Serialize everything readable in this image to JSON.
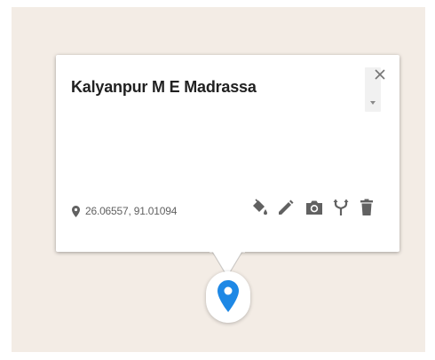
{
  "popup": {
    "title": "Kalyanpur M E Madrassa",
    "coordinates": "26.06557, 91.01094",
    "close_icon": "close-icon",
    "actions": [
      {
        "name": "style-button",
        "icon": "paint-bucket-icon"
      },
      {
        "name": "edit-button",
        "icon": "pencil-icon"
      },
      {
        "name": "add-photo-button",
        "icon": "camera-icon"
      },
      {
        "name": "directions-button",
        "icon": "fork-directions-icon"
      },
      {
        "name": "delete-button",
        "icon": "trash-icon"
      }
    ]
  },
  "marker": {
    "icon": "map-pin-icon",
    "color": "#1e88e5"
  },
  "colors": {
    "map_background": "#f3ece5",
    "icon_gray": "#616161"
  }
}
